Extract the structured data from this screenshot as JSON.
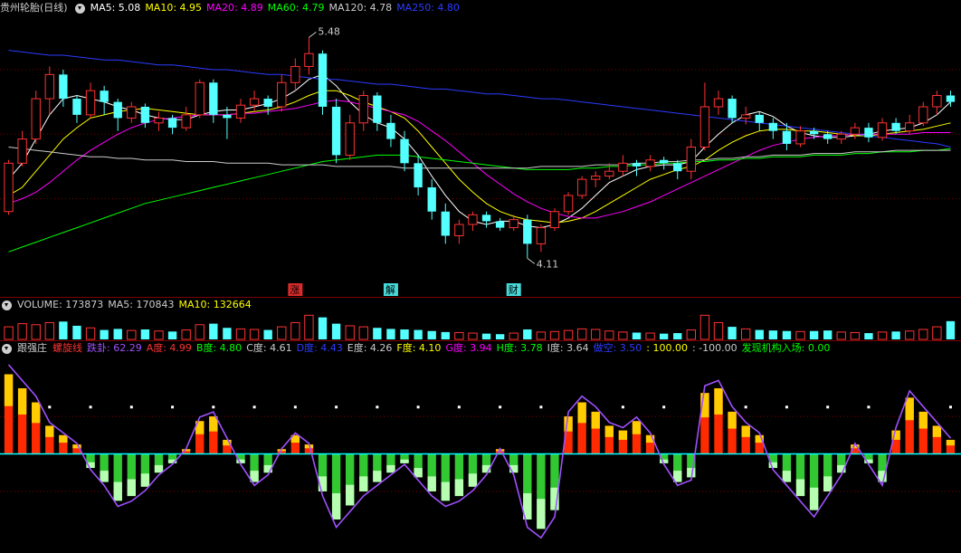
{
  "colors": {
    "up": "#ff3232",
    "down": "#54ffff",
    "ma5": "#ffffff",
    "ma10": "#ffff00",
    "ma20": "#ff00ff",
    "ma60": "#00ff00",
    "ma120": "#cccccc",
    "ma250": "#2c3bff",
    "gridline": "#7a0000",
    "spiral": "#a050ff",
    "green_bar": "#32c832",
    "red_bar": "#ff2a00"
  },
  "price_header": {
    "title": "贵州轮胎(日线)",
    "items": [
      {
        "label": "MA5: 5.08",
        "color": "#ffffff"
      },
      {
        "label": "MA10: 4.95",
        "color": "#ffff00"
      },
      {
        "label": "MA20: 4.89",
        "color": "#ff00ff"
      },
      {
        "label": "MA60: 4.79",
        "color": "#00ff00"
      },
      {
        "label": "MA120: 4.78",
        "color": "#cccccc"
      },
      {
        "label": "MA250: 4.80",
        "color": "#2c3bff"
      }
    ]
  },
  "price_annotations": {
    "high": "5.48",
    "low": "4.11",
    "markers": [
      "涨",
      "解",
      "财"
    ]
  },
  "volume_header": {
    "items": [
      {
        "label": "VOLUME: 173873",
        "color": "#cccccc"
      },
      {
        "label": "MA5: 170843",
        "color": "#cccccc"
      },
      {
        "label": "MA10: 132664",
        "color": "#ffff00"
      }
    ]
  },
  "indicator_header": {
    "title": "跟强庄",
    "items": [
      {
        "label": "螺旋线",
        "color": "#ff3232"
      },
      {
        "label": "跌卦: 62.29",
        "color": "#a050ff"
      },
      {
        "label": "A度: 4.99",
        "color": "#ff3232"
      },
      {
        "label": "B度: 4.80",
        "color": "#00ff00"
      },
      {
        "label": "C度: 4.61",
        "color": "#cccccc"
      },
      {
        "label": "D度: 4.43",
        "color": "#2c3bff"
      },
      {
        "label": "E度: 4.26",
        "color": "#cccccc"
      },
      {
        "label": "F度: 4.10",
        "color": "#ffff00"
      },
      {
        "label": "G度: 3.94",
        "color": "#ff00ff"
      },
      {
        "label": "H度: 3.78",
        "color": "#00ff00"
      },
      {
        "label": "I度: 3.64",
        "color": "#cccccc"
      },
      {
        "label": "做空: 3.50",
        "color": "#2c3bff"
      },
      {
        "label": ": 100.00",
        "color": "#ffff00"
      },
      {
        "label": ": -100.00",
        "color": "#cccccc"
      },
      {
        "label": "发现机构入场: 0.00",
        "color": "#00ff00"
      }
    ]
  },
  "chart_data": {
    "type": "candlestick",
    "price_ylim": [
      4.0,
      5.6
    ],
    "candles": [
      [
        4.4,
        4.7,
        4.38,
        4.72
      ],
      [
        4.7,
        4.85,
        4.68,
        4.9
      ],
      [
        4.85,
        5.1,
        4.82,
        5.15
      ],
      [
        5.1,
        5.25,
        5.0,
        5.3
      ],
      [
        5.25,
        5.1,
        5.05,
        5.28
      ],
      [
        5.1,
        5.0,
        4.95,
        5.12
      ],
      [
        5.0,
        5.15,
        4.98,
        5.2
      ],
      [
        5.15,
        5.08,
        5.0,
        5.18
      ],
      [
        5.08,
        4.98,
        4.9,
        5.1
      ],
      [
        4.98,
        5.05,
        4.95,
        5.08
      ],
      [
        5.05,
        4.95,
        4.92,
        5.07
      ],
      [
        4.95,
        4.98,
        4.9,
        5.02
      ],
      [
        4.98,
        4.92,
        4.88,
        5.0
      ],
      [
        4.92,
        5.0,
        4.9,
        5.05
      ],
      [
        5.0,
        5.2,
        4.98,
        5.22
      ],
      [
        5.2,
        5.0,
        4.95,
        5.22
      ],
      [
        5.0,
        4.98,
        4.85,
        5.05
      ],
      [
        4.98,
        5.06,
        4.95,
        5.1
      ],
      [
        5.06,
        5.1,
        5.02,
        5.15
      ],
      [
        5.1,
        5.05,
        5.0,
        5.12
      ],
      [
        5.05,
        5.2,
        5.02,
        5.25
      ],
      [
        5.2,
        5.3,
        5.15,
        5.35
      ],
      [
        5.3,
        5.38,
        5.25,
        5.48
      ],
      [
        5.38,
        5.05,
        5.0,
        5.4
      ],
      [
        5.05,
        4.75,
        4.7,
        5.1
      ],
      [
        4.75,
        4.95,
        4.72,
        5.0
      ],
      [
        4.95,
        5.12,
        4.9,
        5.15
      ],
      [
        5.12,
        4.95,
        4.9,
        5.14
      ],
      [
        4.95,
        4.85,
        4.8,
        5.0
      ],
      [
        4.85,
        4.7,
        4.65,
        4.9
      ],
      [
        4.7,
        4.55,
        4.5,
        4.75
      ],
      [
        4.55,
        4.4,
        4.35,
        4.6
      ],
      [
        4.4,
        4.25,
        4.2,
        4.45
      ],
      [
        4.25,
        4.32,
        4.2,
        4.35
      ],
      [
        4.32,
        4.38,
        4.28,
        4.4
      ],
      [
        4.38,
        4.34,
        4.3,
        4.4
      ],
      [
        4.34,
        4.3,
        4.28,
        4.36
      ],
      [
        4.3,
        4.35,
        4.28,
        4.38
      ],
      [
        4.35,
        4.2,
        4.11,
        4.38
      ],
      [
        4.2,
        4.3,
        4.15,
        4.32
      ],
      [
        4.3,
        4.4,
        4.28,
        4.42
      ],
      [
        4.4,
        4.5,
        4.38,
        4.52
      ],
      [
        4.5,
        4.6,
        4.48,
        4.62
      ],
      [
        4.6,
        4.62,
        4.55,
        4.65
      ],
      [
        4.62,
        4.65,
        4.6,
        4.7
      ],
      [
        4.65,
        4.7,
        4.62,
        4.75
      ],
      [
        4.7,
        4.68,
        4.62,
        4.72
      ],
      [
        4.68,
        4.72,
        4.65,
        4.75
      ],
      [
        4.72,
        4.7,
        4.66,
        4.74
      ],
      [
        4.7,
        4.65,
        4.6,
        4.72
      ],
      [
        4.65,
        4.8,
        4.6,
        4.85
      ],
      [
        4.8,
        5.05,
        4.78,
        5.2
      ],
      [
        5.05,
        5.1,
        5.0,
        5.15
      ],
      [
        5.1,
        4.98,
        4.95,
        5.12
      ],
      [
        4.98,
        5.0,
        4.94,
        5.05
      ],
      [
        5.0,
        4.95,
        4.9,
        5.02
      ],
      [
        4.95,
        4.9,
        4.85,
        4.98
      ],
      [
        4.9,
        4.82,
        4.78,
        4.95
      ],
      [
        4.82,
        4.9,
        4.8,
        4.93
      ],
      [
        4.9,
        4.88,
        4.85,
        4.92
      ],
      [
        4.88,
        4.85,
        4.82,
        4.9
      ],
      [
        4.85,
        4.88,
        4.82,
        4.9
      ],
      [
        4.88,
        4.92,
        4.85,
        4.95
      ],
      [
        4.92,
        4.86,
        4.83,
        4.95
      ],
      [
        4.86,
        4.95,
        4.84,
        4.98
      ],
      [
        4.95,
        4.9,
        4.88,
        4.98
      ],
      [
        4.9,
        4.95,
        4.88,
        5.0
      ],
      [
        4.95,
        5.05,
        4.93,
        5.08
      ],
      [
        5.05,
        5.12,
        5.0,
        5.15
      ],
      [
        5.12,
        5.08,
        5.05,
        5.15
      ]
    ],
    "ma_lines": [
      {
        "name": "MA5",
        "values": [
          4.6,
          4.7,
          4.85,
          5.0,
          5.1,
          5.12,
          5.1,
          5.08,
          5.05,
          5.03,
          5.0,
          4.98,
          4.97,
          4.97,
          5.0,
          5.02,
          5.03,
          5.03,
          5.05,
          5.07,
          5.1,
          5.15,
          5.22,
          5.25,
          5.18,
          5.08,
          5.0,
          4.95,
          4.92,
          4.85,
          4.75,
          4.62,
          4.5,
          4.4,
          4.34,
          4.32,
          4.34,
          4.34,
          4.31,
          4.3,
          4.32,
          4.36,
          4.42,
          4.5,
          4.58,
          4.62,
          4.66,
          4.68,
          4.69,
          4.69,
          4.71,
          4.8,
          4.88,
          4.95,
          5.0,
          5.02,
          4.99,
          4.93,
          4.89,
          4.87,
          4.86,
          4.86,
          4.87,
          4.88,
          4.9,
          4.91,
          4.92,
          4.95,
          5.0,
          5.08
        ]
      },
      {
        "name": "MA10",
        "values": [
          4.5,
          4.55,
          4.65,
          4.75,
          4.85,
          4.92,
          4.98,
          5.0,
          5.02,
          5.03,
          5.04,
          5.03,
          5.02,
          5.01,
          5.0,
          5.0,
          5.0,
          5.01,
          5.02,
          5.03,
          5.05,
          5.08,
          5.12,
          5.15,
          5.15,
          5.12,
          5.08,
          5.05,
          5.02,
          4.98,
          4.9,
          4.8,
          4.7,
          4.6,
          4.52,
          4.45,
          4.4,
          4.37,
          4.35,
          4.34,
          4.33,
          4.34,
          4.36,
          4.4,
          4.45,
          4.5,
          4.55,
          4.6,
          4.63,
          4.66,
          4.68,
          4.72,
          4.78,
          4.83,
          4.87,
          4.9,
          4.91,
          4.91,
          4.9,
          4.9,
          4.89,
          4.88,
          4.87,
          4.87,
          4.88,
          4.89,
          4.9,
          4.91,
          4.93,
          4.95
        ]
      },
      {
        "name": "MA20",
        "values": [
          4.45,
          4.48,
          4.52,
          4.58,
          4.65,
          4.72,
          4.78,
          4.83,
          4.88,
          4.92,
          4.95,
          4.97,
          4.98,
          4.99,
          5.0,
          5.0,
          5.0,
          5.01,
          5.01,
          5.02,
          5.03,
          5.04,
          5.06,
          5.08,
          5.09,
          5.08,
          5.06,
          5.04,
          5.02,
          5.0,
          4.96,
          4.9,
          4.84,
          4.77,
          4.7,
          4.63,
          4.57,
          4.51,
          4.46,
          4.42,
          4.39,
          4.37,
          4.36,
          4.36,
          4.38,
          4.4,
          4.43,
          4.46,
          4.5,
          4.54,
          4.58,
          4.62,
          4.66,
          4.7,
          4.74,
          4.78,
          4.81,
          4.83,
          4.85,
          4.86,
          4.87,
          4.87,
          4.88,
          4.88,
          4.88,
          4.88,
          4.88,
          4.89,
          4.89,
          4.89
        ]
      },
      {
        "name": "MA60",
        "values": [
          4.15,
          4.18,
          4.21,
          4.24,
          4.27,
          4.3,
          4.33,
          4.36,
          4.39,
          4.42,
          4.45,
          4.47,
          4.49,
          4.51,
          4.53,
          4.55,
          4.57,
          4.59,
          4.61,
          4.63,
          4.65,
          4.67,
          4.69,
          4.71,
          4.72,
          4.73,
          4.74,
          4.75,
          4.75,
          4.75,
          4.74,
          4.73,
          4.72,
          4.71,
          4.7,
          4.69,
          4.68,
          4.67,
          4.66,
          4.66,
          4.66,
          4.66,
          4.67,
          4.67,
          4.68,
          4.68,
          4.69,
          4.69,
          4.7,
          4.7,
          4.71,
          4.71,
          4.72,
          4.72,
          4.73,
          4.73,
          4.74,
          4.74,
          4.74,
          4.75,
          4.75,
          4.75,
          4.76,
          4.76,
          4.77,
          4.77,
          4.77,
          4.78,
          4.78,
          4.79
        ]
      },
      {
        "name": "MA120",
        "values": [
          4.8,
          4.79,
          4.78,
          4.77,
          4.76,
          4.75,
          4.74,
          4.74,
          4.73,
          4.73,
          4.72,
          4.72,
          4.72,
          4.71,
          4.71,
          4.71,
          4.7,
          4.7,
          4.7,
          4.7,
          4.69,
          4.69,
          4.69,
          4.69,
          4.68,
          4.68,
          4.68,
          4.68,
          4.68,
          4.67,
          4.67,
          4.67,
          4.67,
          4.67,
          4.67,
          4.67,
          4.67,
          4.67,
          4.67,
          4.68,
          4.68,
          4.68,
          4.68,
          4.69,
          4.69,
          4.69,
          4.7,
          4.7,
          4.71,
          4.71,
          4.72,
          4.72,
          4.73,
          4.73,
          4.74,
          4.74,
          4.75,
          4.75,
          4.75,
          4.76,
          4.76,
          4.76,
          4.77,
          4.77,
          4.77,
          4.78,
          4.78,
          4.78,
          4.78,
          4.78
        ]
      },
      {
        "name": "MA250",
        "values": [
          5.4,
          5.39,
          5.38,
          5.37,
          5.37,
          5.36,
          5.35,
          5.34,
          5.34,
          5.33,
          5.32,
          5.31,
          5.31,
          5.3,
          5.29,
          5.28,
          5.28,
          5.27,
          5.26,
          5.25,
          5.25,
          5.24,
          5.23,
          5.22,
          5.22,
          5.21,
          5.2,
          5.19,
          5.19,
          5.18,
          5.17,
          5.16,
          5.16,
          5.15,
          5.14,
          5.13,
          5.13,
          5.12,
          5.11,
          5.1,
          5.1,
          5.09,
          5.08,
          5.07,
          5.06,
          5.05,
          5.04,
          5.03,
          5.02,
          5.01,
          5.0,
          4.99,
          4.98,
          4.97,
          4.96,
          4.95,
          4.94,
          4.93,
          4.92,
          4.91,
          4.9,
          4.89,
          4.88,
          4.87,
          4.86,
          4.85,
          4.84,
          4.83,
          4.82,
          4.8
        ]
      }
    ],
    "volume": [
      120,
      150,
      140,
      160,
      170,
      130,
      110,
      90,
      100,
      85,
      95,
      80,
      75,
      90,
      140,
      150,
      110,
      100,
      95,
      90,
      120,
      160,
      230,
      210,
      150,
      130,
      120,
      110,
      100,
      95,
      90,
      80,
      70,
      65,
      60,
      55,
      50,
      60,
      95,
      70,
      75,
      85,
      100,
      95,
      80,
      70,
      65,
      60,
      55,
      60,
      90,
      230,
      160,
      120,
      100,
      90,
      85,
      80,
      75,
      80,
      85,
      70,
      65,
      60,
      70,
      75,
      80,
      95,
      120,
      174
    ],
    "indicator_ylim": [
      -100,
      100
    ],
    "indicator": [
      85,
      70,
      55,
      30,
      20,
      10,
      -15,
      -30,
      -50,
      -45,
      -35,
      -20,
      -10,
      5,
      35,
      40,
      15,
      -10,
      -30,
      -20,
      5,
      20,
      10,
      -40,
      -70,
      -55,
      -40,
      -30,
      -20,
      -10,
      -25,
      -40,
      -50,
      -45,
      -35,
      -20,
      5,
      -20,
      -70,
      -80,
      -60,
      40,
      55,
      45,
      30,
      25,
      35,
      20,
      -10,
      -30,
      -25,
      65,
      70,
      45,
      30,
      20,
      -15,
      -30,
      -45,
      -60,
      -40,
      -20,
      10,
      -10,
      -30,
      25,
      60,
      45,
      30,
      15
    ]
  }
}
